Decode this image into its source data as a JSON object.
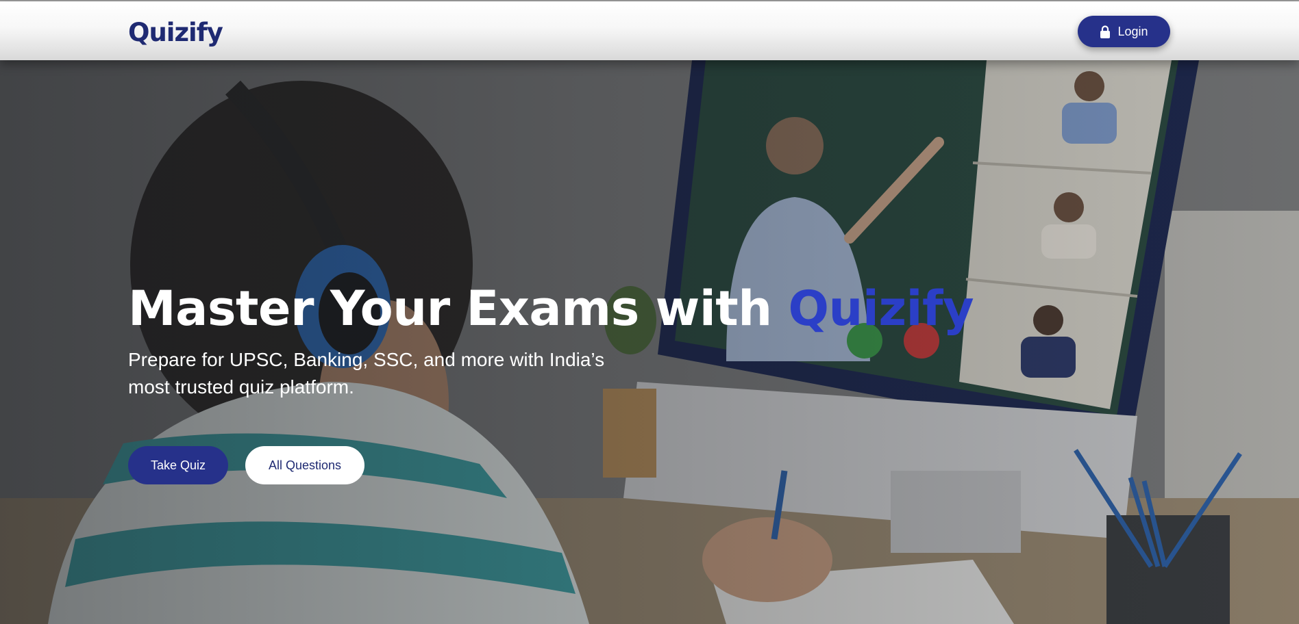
{
  "header": {
    "logo_text": "Quizify",
    "login_label": "Login",
    "login_icon": "lock-icon"
  },
  "hero": {
    "title_prefix": "Master Your Exams with ",
    "title_accent": "Quizify",
    "subtitle": "Prepare for UPSC, Banking, SSC, and more with India’s most trusted quiz platform.",
    "primary_button": "Take Quiz",
    "secondary_button": "All Questions",
    "background_image": "child-in-online-class-photo"
  },
  "colors": {
    "brand": "#1f2a72",
    "button": "#26318a",
    "accent": "#2b3fc7"
  }
}
